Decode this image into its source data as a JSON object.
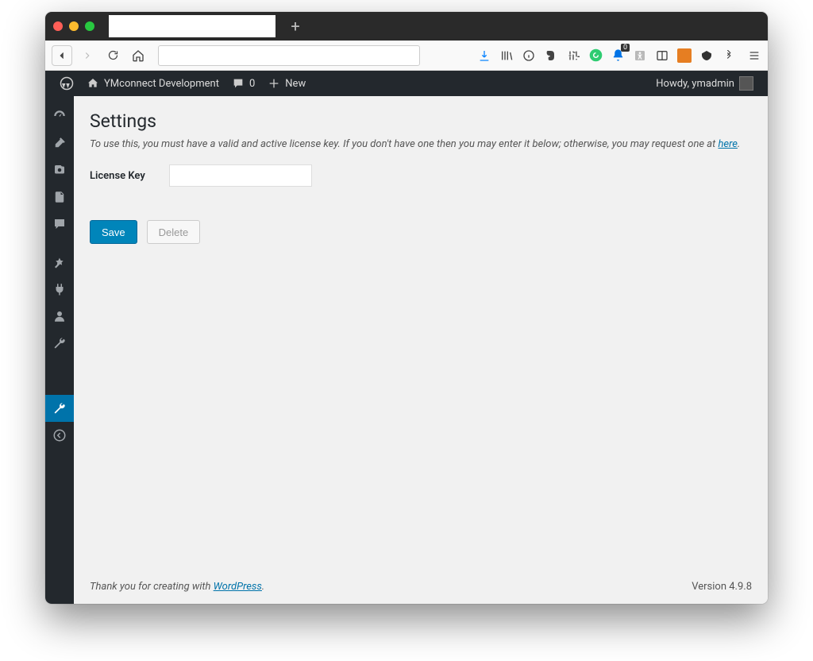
{
  "browser": {
    "newtab_glyph": "+",
    "toolbar_icons": {
      "download": "download-icon",
      "library": "library-icon",
      "info": "info-icon",
      "evernote": "evernote-icon",
      "tune": "tune-icon",
      "grammarly": "grammarly-icon",
      "notification": "notification-icon",
      "notification_count": "0",
      "accessibility": "accessibility-icon",
      "reader": "reader-icon",
      "app1": "app1-icon",
      "app2": "app2-icon",
      "overflow": "overflow-icon",
      "menu": "menu-icon"
    }
  },
  "wpbar": {
    "site_name": "YMconnect Development",
    "comments_count": "0",
    "new_label": "New",
    "greeting": "Howdy, ymadmin"
  },
  "page": {
    "title": "Settings",
    "description_prefix": "To use this, you must have a valid and active license key. If you don't have one then you may enter it below; otherwise, you may request one at ",
    "description_link": "here",
    "description_suffix": ".",
    "license_label": "License Key",
    "license_value": "",
    "save_label": "Save",
    "delete_label": "Delete"
  },
  "footer": {
    "thanks_prefix": "Thank you for creating with ",
    "thanks_link": "WordPress",
    "thanks_suffix": ".",
    "version": "Version 4.9.8"
  }
}
